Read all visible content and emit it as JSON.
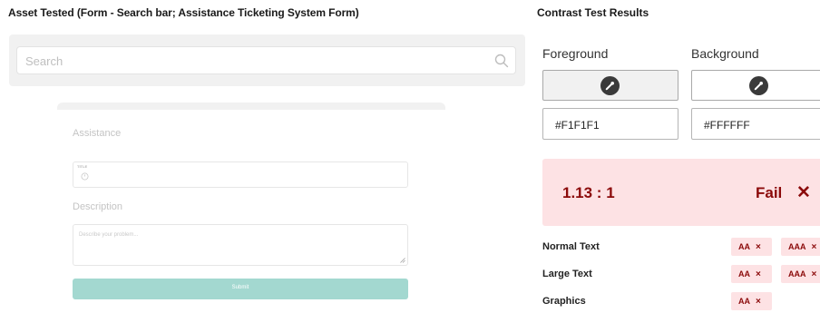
{
  "headers": {
    "asset_tested": "Asset Tested (Form - Search bar; Assistance Ticketing System Form)",
    "contrast_results": "Contrast Test Results"
  },
  "search": {
    "placeholder": "Search",
    "icon": "search-icon"
  },
  "form": {
    "heading": "Assistance",
    "title_label": "TITLE",
    "description_label": "Description",
    "description_placeholder": "Describe your problem...",
    "submit_label": "Submit",
    "submit_color": "#A3D8D0"
  },
  "contrast": {
    "foreground_label": "Foreground",
    "background_label": "Background",
    "foreground_hex": "#F1F1F1",
    "background_hex": "#FFFFFF",
    "ratio": "1.13 : 1",
    "verdict": "Fail",
    "verdict_icon": "close-icon",
    "fail_color": "#8B0A0A",
    "fail_bg_color": "#FDE2E4",
    "rows": [
      {
        "label": "Normal Text",
        "badges": [
          "AA",
          "AAA"
        ]
      },
      {
        "label": "Large Text",
        "badges": [
          "AA",
          "AAA"
        ]
      },
      {
        "label": "Graphics",
        "badges": [
          "AA"
        ]
      }
    ],
    "badge_mark": "×"
  }
}
